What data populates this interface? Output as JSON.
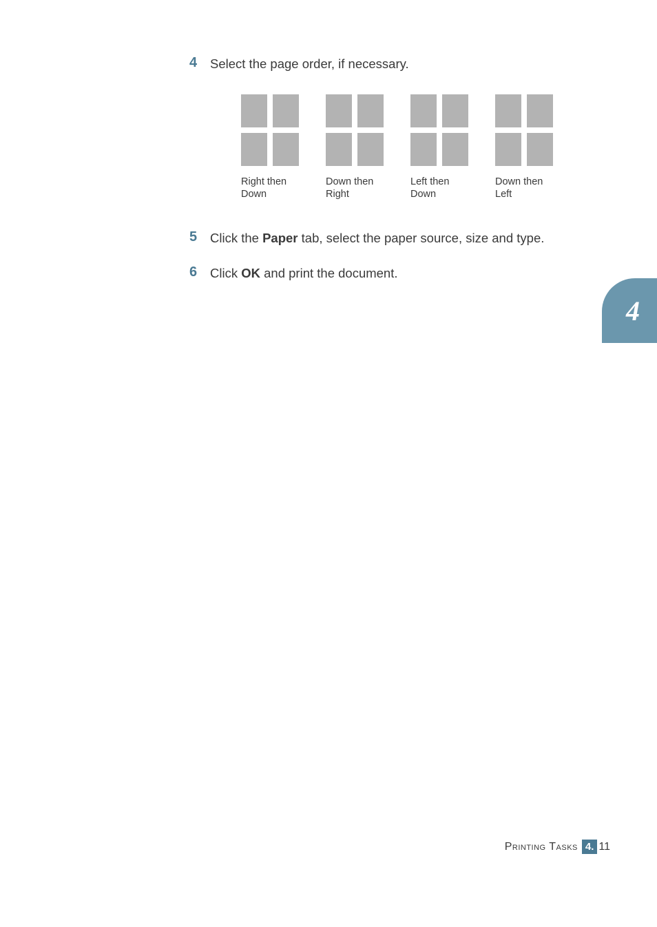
{
  "steps": [
    {
      "num": "4",
      "text": "Select the page order, if necessary."
    },
    {
      "num": "5",
      "pre": "Click the ",
      "bold": "Paper",
      "post": " tab, select the paper source, size and type."
    },
    {
      "num": "6",
      "pre": "Click ",
      "bold": "OK",
      "post": " and print the document."
    }
  ],
  "layouts": [
    {
      "label_line1": "Right then",
      "label_line2": "Down"
    },
    {
      "label_line1": "Down then",
      "label_line2": "Right"
    },
    {
      "label_line1": "Left then",
      "label_line2": "Down"
    },
    {
      "label_line1": "Down then",
      "label_line2": "Left"
    }
  ],
  "chapter_tab": "4",
  "footer": {
    "title": "Printing Tasks",
    "chapter": "4.",
    "page": "11"
  }
}
